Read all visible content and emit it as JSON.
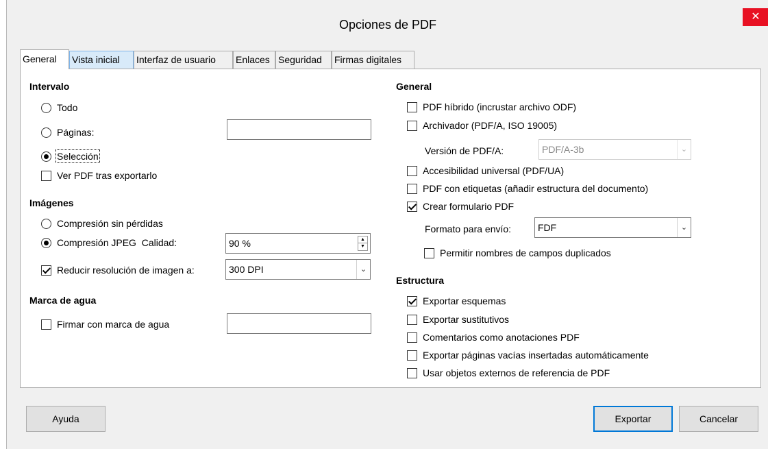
{
  "window": {
    "title": "Opciones de PDF",
    "close": "✕"
  },
  "tabs": [
    {
      "label": "General",
      "active": true
    },
    {
      "label": "Vista inicial"
    },
    {
      "label": "Interfaz de usuario"
    },
    {
      "label": "Enlaces"
    },
    {
      "label": "Seguridad"
    },
    {
      "label": "Firmas digitales"
    }
  ],
  "range": {
    "heading": "Intervalo",
    "all": {
      "label": "Todo",
      "checked": false
    },
    "pages": {
      "label": "Páginas:",
      "checked": false,
      "value": ""
    },
    "selection": {
      "label": "Selección",
      "checked": true
    },
    "view_after": {
      "label": "Ver PDF tras exportarlo",
      "checked": false
    }
  },
  "images": {
    "heading": "Imágenes",
    "lossless": {
      "label": "Compresión sin pérdidas",
      "checked": false
    },
    "jpeg": {
      "label": "Compresión JPEG  Calidad:",
      "checked": true,
      "value": "90 %"
    },
    "reduce": {
      "label": "Reducir resolución de imagen a:",
      "checked": true,
      "value": "300 DPI"
    }
  },
  "watermark": {
    "heading": "Marca de agua",
    "sign": {
      "label": "Firmar con marca de agua",
      "checked": false,
      "value": ""
    }
  },
  "general": {
    "heading": "General",
    "hybrid": {
      "label": "PDF híbrido (incrustar archivo ODF)",
      "checked": false
    },
    "archive": {
      "label": "Archivador (PDF/A, ISO 19005)",
      "checked": false
    },
    "pdfa_version": {
      "label": "Versión de PDF/A:",
      "value": "PDF/A-3b"
    },
    "accessibility": {
      "label": "Accesibilidad universal (PDF/UA)",
      "checked": false
    },
    "tagged": {
      "label": "PDF con etiquetas (añadir estructura del documento)",
      "checked": false
    },
    "form": {
      "label": "Crear formulario PDF",
      "checked": true
    },
    "submit_format": {
      "label": "Formato para envío:",
      "value": "FDF"
    },
    "duplicate_names": {
      "label": "Permitir nombres de campos duplicados",
      "checked": false
    }
  },
  "structure": {
    "heading": "Estructura",
    "outlines": {
      "label": "Exportar esquemas",
      "checked": true
    },
    "placeholders": {
      "label": "Exportar sustitutivos",
      "checked": false
    },
    "comments": {
      "label": "Comentarios como anotaciones PDF",
      "checked": false
    },
    "blank_pages": {
      "label": "Exportar páginas vacías insertadas automáticamente",
      "checked": false
    },
    "reference_xobjects": {
      "label": "Usar objetos externos de referencia de PDF",
      "checked": false
    }
  },
  "buttons": {
    "help": "Ayuda",
    "export": "Exportar",
    "cancel": "Cancelar"
  }
}
